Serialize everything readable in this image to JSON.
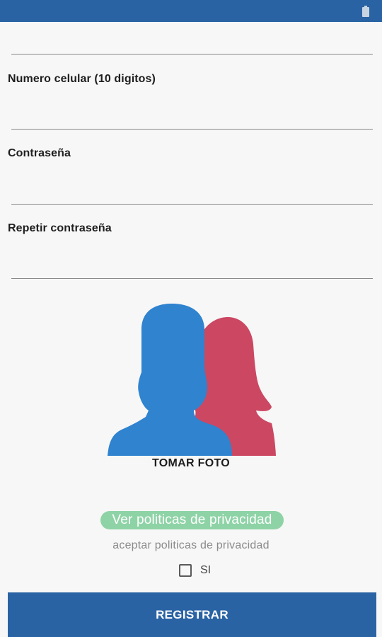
{
  "status_bar": {
    "color": "#2a63a4",
    "icons": [
      "battery-icon"
    ]
  },
  "form": {
    "fields": [
      {
        "label": "",
        "value": "",
        "placeholder": ""
      },
      {
        "label": "Numero celular (10 digitos)",
        "value": "",
        "placeholder": ""
      },
      {
        "label": "Contraseña",
        "value": "",
        "placeholder": ""
      },
      {
        "label": "Repetir contraseña",
        "value": "",
        "placeholder": ""
      }
    ]
  },
  "photo": {
    "label": "TOMAR FOTO",
    "icon": "people-avatar-icon",
    "colors": {
      "male": "#2f83cf",
      "female": "#cc4762"
    }
  },
  "privacy": {
    "link_label": "Ver politicas de privacidad",
    "link_color": "#8ed3a6",
    "accept_text": "aceptar politicas de privacidad",
    "checkbox_label": "SI",
    "checkbox_checked": false
  },
  "register": {
    "label": "REGISTRAR",
    "color": "#2a63a4"
  }
}
